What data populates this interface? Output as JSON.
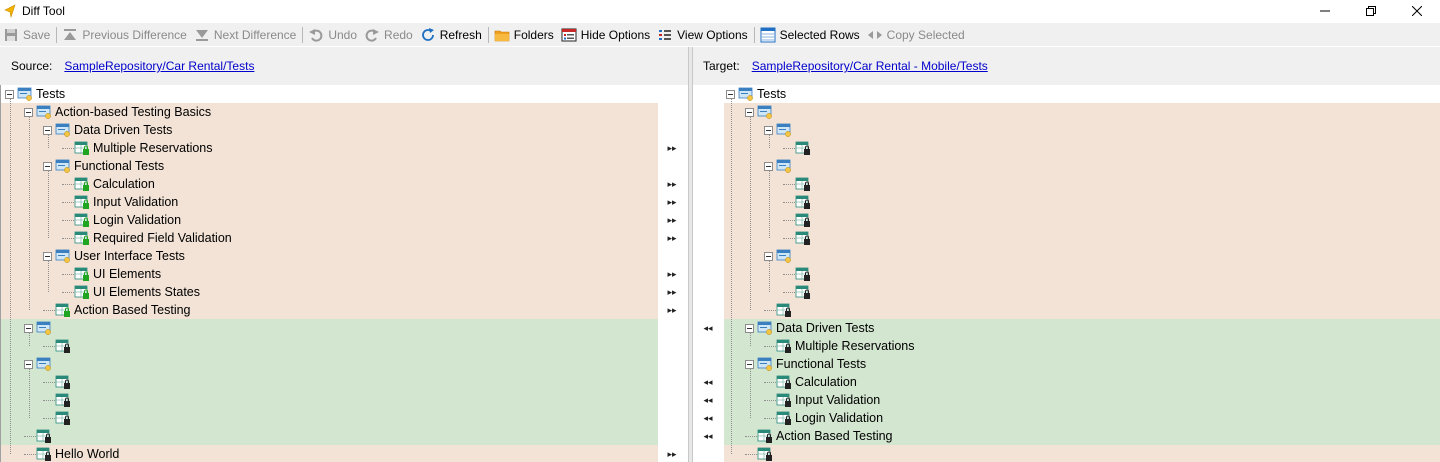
{
  "window": {
    "title": "Diff Tool"
  },
  "toolbar": {
    "save": "Save",
    "previous_difference": "Previous Difference",
    "next_difference": "Next Difference",
    "undo": "Undo",
    "redo": "Redo",
    "refresh": "Refresh",
    "folders": "Folders",
    "hide_options": "Hide Options",
    "view_options": "View Options",
    "selected_rows": "Selected Rows",
    "copy_selected": "Copy Selected"
  },
  "source": {
    "label": "Source:",
    "path": "SampleRepository/Car Rental/Tests"
  },
  "target": {
    "label": "Target:",
    "path": "SampleRepository/Car Rental - Mobile/Tests"
  },
  "colors": {
    "changed": "#f2e3d6",
    "added": "#d3e6d0",
    "link": "#0000cc"
  },
  "source_tree": [
    {
      "label": "Tests",
      "level": 0,
      "icon": "folder-root-icon",
      "row": "white",
      "expanded": true,
      "arrow": ""
    },
    {
      "label": "Action-based Testing Basics",
      "level": 1,
      "icon": "folder-icon",
      "row": "orange",
      "expanded": true,
      "arrow": ""
    },
    {
      "label": "Data Driven Tests",
      "level": 2,
      "icon": "folder-icon",
      "row": "orange",
      "expanded": true,
      "arrow": ""
    },
    {
      "label": "Multiple Reservations",
      "level": 3,
      "icon": "test-green-icon",
      "row": "orange",
      "expanded": null,
      "arrow": "right"
    },
    {
      "label": "Functional Tests",
      "level": 2,
      "icon": "folder-icon",
      "row": "orange",
      "expanded": true,
      "arrow": ""
    },
    {
      "label": "Calculation",
      "level": 3,
      "icon": "test-green-icon",
      "row": "orange",
      "expanded": null,
      "arrow": "right"
    },
    {
      "label": "Input Validation",
      "level": 3,
      "icon": "test-green-icon",
      "row": "orange",
      "expanded": null,
      "arrow": "right"
    },
    {
      "label": "Login Validation",
      "level": 3,
      "icon": "test-green-icon",
      "row": "orange",
      "expanded": null,
      "arrow": "right"
    },
    {
      "label": "Required Field Validation",
      "level": 3,
      "icon": "test-green-icon",
      "row": "orange",
      "expanded": null,
      "arrow": "right"
    },
    {
      "label": "User Interface Tests",
      "level": 2,
      "icon": "folder-icon",
      "row": "orange",
      "expanded": true,
      "arrow": ""
    },
    {
      "label": "UI Elements",
      "level": 3,
      "icon": "test-green-icon",
      "row": "orange",
      "expanded": null,
      "arrow": "right"
    },
    {
      "label": "UI Elements States",
      "level": 3,
      "icon": "test-green-icon",
      "row": "orange",
      "expanded": null,
      "arrow": "right"
    },
    {
      "label": "Action Based Testing",
      "level": 2,
      "icon": "test-green-icon",
      "row": "orange",
      "expanded": null,
      "arrow": "right"
    },
    {
      "label": "",
      "level": 1,
      "icon": "folder-icon",
      "row": "green",
      "expanded": true,
      "arrow": ""
    },
    {
      "label": "",
      "level": 2,
      "icon": "test-lock-icon",
      "row": "green",
      "expanded": null,
      "arrow": ""
    },
    {
      "label": "",
      "level": 1,
      "icon": "folder-icon",
      "row": "green",
      "expanded": true,
      "arrow": ""
    },
    {
      "label": "",
      "level": 2,
      "icon": "test-lock-icon",
      "row": "green",
      "expanded": null,
      "arrow": ""
    },
    {
      "label": "",
      "level": 2,
      "icon": "test-lock-icon",
      "row": "green",
      "expanded": null,
      "arrow": ""
    },
    {
      "label": "",
      "level": 2,
      "icon": "test-lock-icon",
      "row": "green",
      "expanded": null,
      "arrow": ""
    },
    {
      "label": "",
      "level": 1,
      "icon": "test-lock-icon",
      "row": "green",
      "expanded": null,
      "arrow": ""
    },
    {
      "label": "Hello World",
      "level": 1,
      "icon": "test-lock-icon",
      "row": "orange",
      "expanded": null,
      "arrow": "right"
    }
  ],
  "target_tree": [
    {
      "label": "Tests",
      "level": 0,
      "icon": "folder-root-icon",
      "row": "white",
      "expanded": true,
      "arrow": ""
    },
    {
      "label": "",
      "level": 1,
      "icon": "folder-icon",
      "row": "orange",
      "expanded": true,
      "arrow": ""
    },
    {
      "label": "",
      "level": 2,
      "icon": "folder-icon",
      "row": "orange",
      "expanded": true,
      "arrow": ""
    },
    {
      "label": "",
      "level": 3,
      "icon": "test-lock-icon",
      "row": "orange",
      "expanded": null,
      "arrow": ""
    },
    {
      "label": "",
      "level": 2,
      "icon": "folder-icon",
      "row": "orange",
      "expanded": true,
      "arrow": ""
    },
    {
      "label": "",
      "level": 3,
      "icon": "test-lock-icon",
      "row": "orange",
      "expanded": null,
      "arrow": ""
    },
    {
      "label": "",
      "level": 3,
      "icon": "test-lock-icon",
      "row": "orange",
      "expanded": null,
      "arrow": ""
    },
    {
      "label": "",
      "level": 3,
      "icon": "test-lock-icon",
      "row": "orange",
      "expanded": null,
      "arrow": ""
    },
    {
      "label": "",
      "level": 3,
      "icon": "test-lock-icon",
      "row": "orange",
      "expanded": null,
      "arrow": ""
    },
    {
      "label": "",
      "level": 2,
      "icon": "folder-icon",
      "row": "orange",
      "expanded": true,
      "arrow": ""
    },
    {
      "label": "",
      "level": 3,
      "icon": "test-lock-icon",
      "row": "orange",
      "expanded": null,
      "arrow": ""
    },
    {
      "label": "",
      "level": 3,
      "icon": "test-lock-icon",
      "row": "orange",
      "expanded": null,
      "arrow": ""
    },
    {
      "label": "",
      "level": 2,
      "icon": "test-lock-icon",
      "row": "orange",
      "expanded": null,
      "arrow": ""
    },
    {
      "label": "Data Driven Tests",
      "level": 1,
      "icon": "folder-icon",
      "row": "green",
      "expanded": true,
      "arrow": "left"
    },
    {
      "label": "Multiple Reservations",
      "level": 2,
      "icon": "test-lock-icon",
      "row": "green",
      "expanded": null,
      "arrow": ""
    },
    {
      "label": "Functional Tests",
      "level": 1,
      "icon": "folder-icon",
      "row": "green",
      "expanded": true,
      "arrow": ""
    },
    {
      "label": "Calculation",
      "level": 2,
      "icon": "test-lock-icon",
      "row": "green",
      "expanded": null,
      "arrow": "left"
    },
    {
      "label": "Input Validation",
      "level": 2,
      "icon": "test-lock-icon",
      "row": "green",
      "expanded": null,
      "arrow": "left"
    },
    {
      "label": "Login Validation",
      "level": 2,
      "icon": "test-lock-icon",
      "row": "green",
      "expanded": null,
      "arrow": "left"
    },
    {
      "label": "Action Based Testing",
      "level": 1,
      "icon": "test-lock-icon",
      "row": "green",
      "expanded": null,
      "arrow": "left"
    },
    {
      "label": "",
      "level": 1,
      "icon": "test-lock-icon",
      "row": "orange",
      "expanded": null,
      "arrow": ""
    }
  ]
}
